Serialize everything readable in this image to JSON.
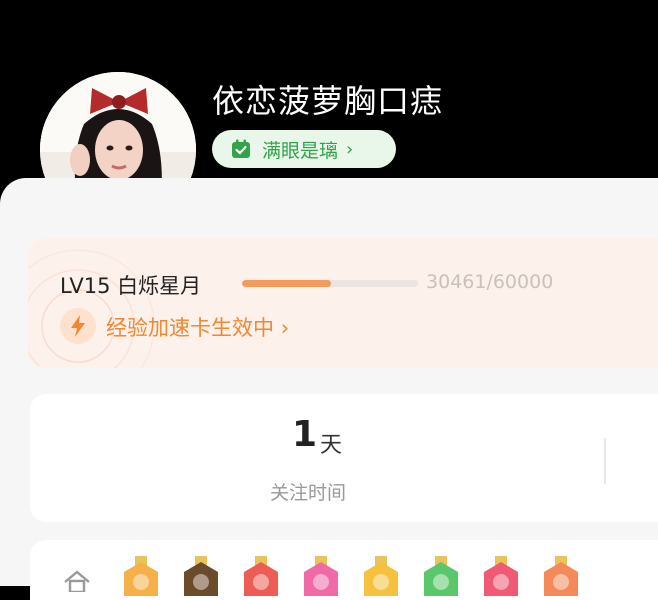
{
  "profile": {
    "username": "依恋菠萝胸口痣",
    "tag_label": "满眼是璃",
    "tag_chevron": "›",
    "verified_badge": "V",
    "avatar_icon": "avatar-girl-red-bow"
  },
  "level": {
    "title": "LV15 白烁星月",
    "progress_text": "30461/60000",
    "progress_fraction": 0.5077,
    "boost_label": "经验加速卡生效中",
    "boost_chevron": "›",
    "boost_icon": "lightning-icon"
  },
  "stats": {
    "value": "1",
    "unit": "天",
    "label": "关注时间"
  },
  "badges": {
    "icon": "house-icon",
    "colors": [
      "#f6b04a",
      "#6b4b2a",
      "#ee5d55",
      "#f06aa8",
      "#f6c13e",
      "#5ac86a",
      "#f05a74",
      "#f48a5a"
    ]
  },
  "colors": {
    "accent": "#f46c22",
    "tag_green": "#33a34a",
    "boost_orange": "#f4862e",
    "progress": "#f49a5c"
  }
}
